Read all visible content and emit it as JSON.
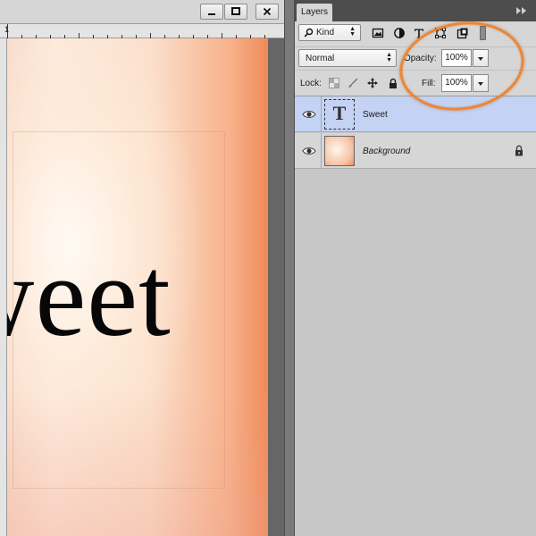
{
  "document": {
    "ruler_label": "1",
    "canvas_text": "weet",
    "window_buttons": {
      "minimize_icon": "minimize-icon",
      "maximize_icon": "maximize-icon",
      "close_icon": "close-icon"
    }
  },
  "layers_panel": {
    "tab_label": "Layers",
    "filter": {
      "kind_label": "Kind",
      "icons": [
        "pixel-filter-icon",
        "adjustment-filter-icon",
        "type-filter-icon",
        "shape-filter-icon",
        "smart-object-filter-icon"
      ]
    },
    "blend_mode": "Normal",
    "opacity_label": "Opacity:",
    "opacity_value": "100%",
    "lock_label": "Lock:",
    "fill_label": "Fill:",
    "fill_value": "100%",
    "layers": [
      {
        "name": "Sweet",
        "kind": "text",
        "selected": true,
        "visible": true
      },
      {
        "name": "Background",
        "kind": "image",
        "selected": false,
        "visible": true,
        "locked": true
      }
    ]
  },
  "colors": {
    "selection": "#c4d2f3",
    "highlight": "#ee8633",
    "panel": "#d6d6d6"
  }
}
